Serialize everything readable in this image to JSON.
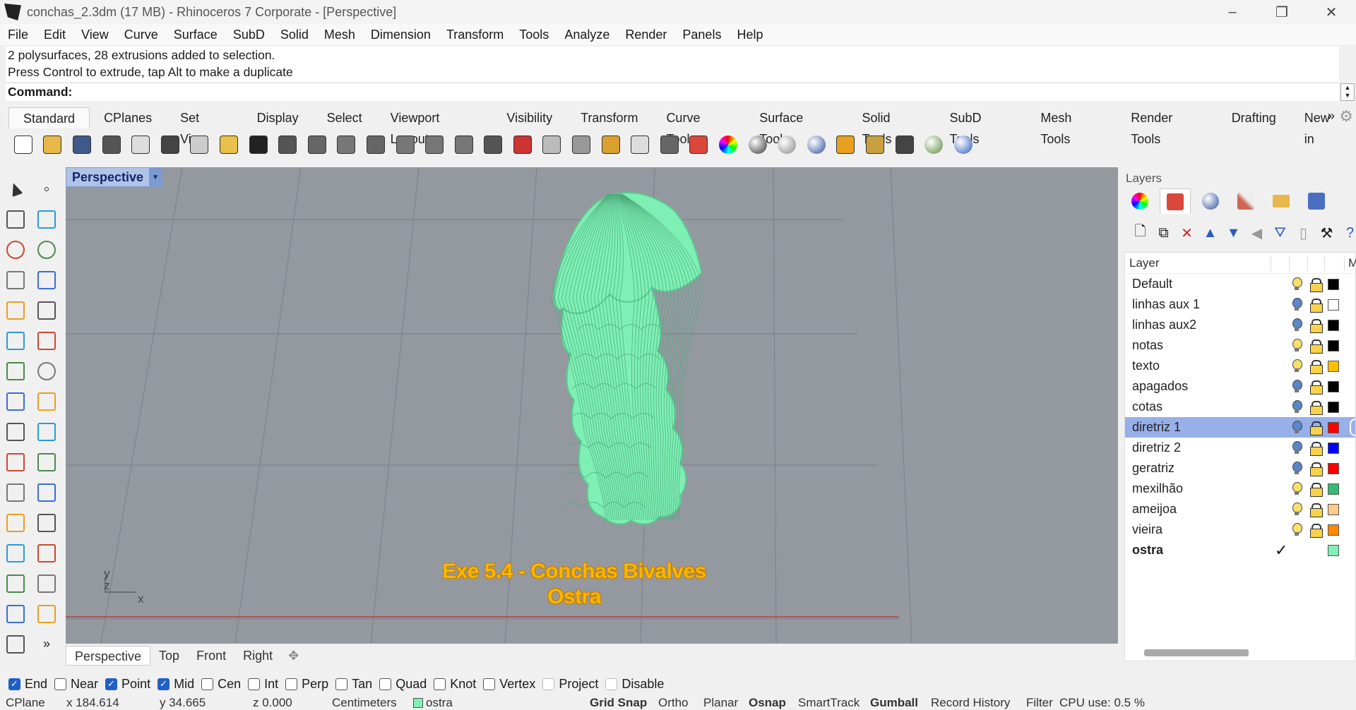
{
  "window": {
    "title": "conchas_2.3dm (17 MB) - Rhinoceros 7 Corporate - [Perspective]",
    "controls": [
      "–",
      "❐",
      "✕"
    ]
  },
  "menu": [
    "File",
    "Edit",
    "View",
    "Curve",
    "Surface",
    "SubD",
    "Solid",
    "Mesh",
    "Dimension",
    "Transform",
    "Tools",
    "Analyze",
    "Render",
    "Panels",
    "Help"
  ],
  "command": {
    "history": [
      "2 polysurfaces, 28 extrusions added to selection.",
      "Press Control to extrude, tap Alt to make a duplicate"
    ],
    "prompt": "Command:"
  },
  "toolbar_tabs": [
    "Standard",
    "CPlanes",
    "Set View",
    "Display",
    "Select",
    "Viewport Layout",
    "Visibility",
    "Transform",
    "Curve Tools",
    "Surface Tools",
    "Solid Tools",
    "SubD Tools",
    "Mesh Tools",
    "Render Tools",
    "Drafting",
    "New in"
  ],
  "toolbar_tabs_more": "»",
  "toolbar_icons": [
    "new-file-icon",
    "open-file-icon",
    "save-icon",
    "print-icon",
    "import-icon",
    "cut-icon",
    "copy-icon",
    "paste-icon",
    "undo-icon",
    "pan-icon",
    "rotate-view-icon",
    "zoom-window-icon",
    "zoom-dynamic-icon",
    "zoom-extents-icon",
    "zoom-selected-icon",
    "zoom-previous-icon",
    "viewport-layout-icon",
    "car-icon",
    "named-cplane-icon",
    "isolate-icon",
    "point-icon",
    "light-icon",
    "lock-icon",
    "layers-icon",
    "color-wheel-icon",
    "shade-icon",
    "render-sphere-icon",
    "blue-sphere-icon",
    "dimension-icon",
    "options-gear-icon",
    "snap-grid-icon",
    "globe-icon",
    "help-icon"
  ],
  "viewport": {
    "name": "Perspective",
    "caption_line1": "Exe 5.4 - Conchas Bivalves",
    "caption_line2": "Ostra",
    "axis_y": "y",
    "axis_z": "z",
    "axis_x": "x",
    "object_color": "#7ff0b4"
  },
  "viewport_tabs": [
    "Perspective",
    "Top",
    "Front",
    "Right"
  ],
  "layers_panel": {
    "title": "Layers",
    "column_header": "Layer",
    "column_header_extra": "M",
    "layers": [
      {
        "name": "Default",
        "bulb": "on",
        "color": "#000000"
      },
      {
        "name": "linhas aux 1",
        "bulb": "off",
        "color": "#ffffff"
      },
      {
        "name": "linhas aux2",
        "bulb": "off",
        "color": "#000000"
      },
      {
        "name": "notas",
        "bulb": "on",
        "color": "#000000"
      },
      {
        "name": "texto",
        "bulb": "on",
        "color": "#ffbf00"
      },
      {
        "name": "apagados",
        "bulb": "off",
        "color": "#000000"
      },
      {
        "name": "cotas",
        "bulb": "off",
        "color": "#000000"
      },
      {
        "name": "diretriz 1",
        "bulb": "off",
        "color": "#ff0000",
        "selected": true
      },
      {
        "name": "diretriz 2",
        "bulb": "off",
        "color": "#0000ff"
      },
      {
        "name": "geratriz",
        "bulb": "off",
        "color": "#ff0000"
      },
      {
        "name": "mexilhão",
        "bulb": "on",
        "color": "#33bb77"
      },
      {
        "name": "ameijoa",
        "bulb": "on",
        "color": "#ffcc88"
      },
      {
        "name": "vieira",
        "bulb": "on",
        "color": "#ff8800"
      },
      {
        "name": "ostra",
        "bulb": "none",
        "color": "#7ff0b4",
        "current": true
      }
    ]
  },
  "osnaps": [
    {
      "label": "End",
      "checked": true
    },
    {
      "label": "Near",
      "checked": false
    },
    {
      "label": "Point",
      "checked": true
    },
    {
      "label": "Mid",
      "checked": true
    },
    {
      "label": "Cen",
      "checked": false
    },
    {
      "label": "Int",
      "checked": false
    },
    {
      "label": "Perp",
      "checked": false
    },
    {
      "label": "Tan",
      "checked": false
    },
    {
      "label": "Quad",
      "checked": false
    },
    {
      "label": "Knot",
      "checked": false
    },
    {
      "label": "Vertex",
      "checked": false
    },
    {
      "label": "Project",
      "checked": false,
      "light": true
    },
    {
      "label": "Disable",
      "checked": false,
      "light": true
    }
  ],
  "status": {
    "cplane": "CPlane",
    "x": "x 184.614",
    "y": "y 34.665",
    "z": "z 0.000",
    "units": "Centimeters",
    "layer": "ostra",
    "grid_snap": "Grid Snap",
    "ortho": "Ortho",
    "planar": "Planar",
    "osnap": "Osnap",
    "smarttrack": "SmartTrack",
    "gumball": "Gumball",
    "record_history": "Record History",
    "filter": "Filter",
    "cpu": "CPU use: 0.5 %"
  }
}
